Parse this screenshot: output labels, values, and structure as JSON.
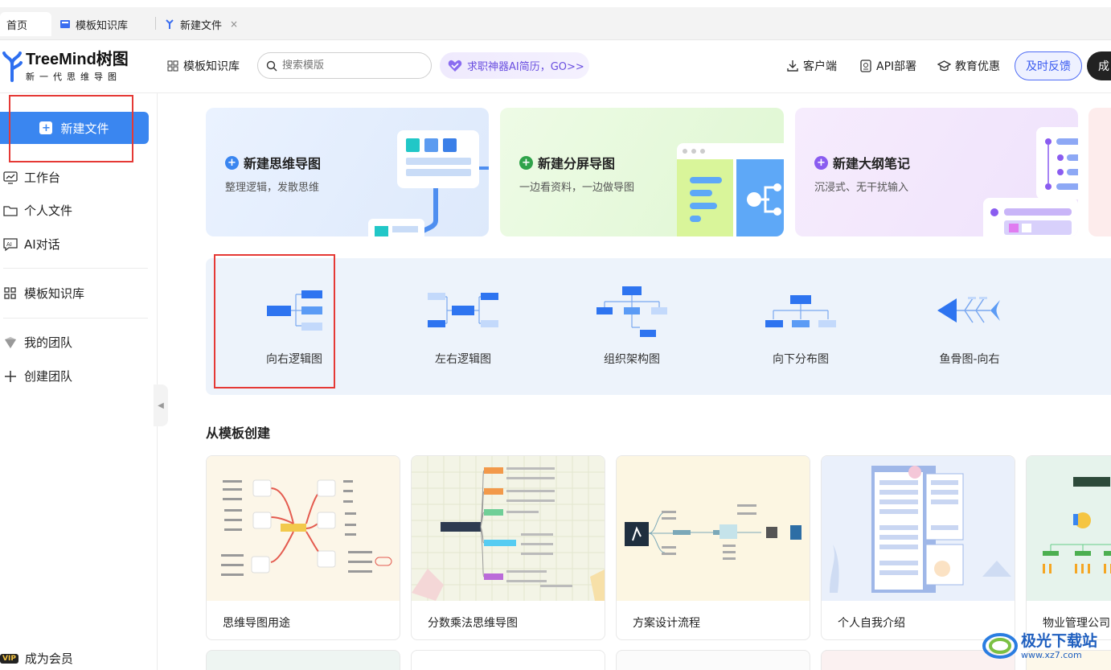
{
  "tabs": [
    {
      "label": "首页"
    },
    {
      "label": "模板知识库"
    },
    {
      "label": "新建文件",
      "close": "×"
    }
  ],
  "logo": {
    "name": "TreeMind",
    "name_cn": "树图",
    "tagline": "新一代思维导图"
  },
  "topbar": {
    "template_library": "模板知识库",
    "search_placeholder": "搜索模版",
    "promo": "求职神器AI简历，GO>>",
    "client": "客户端",
    "api": "API部署",
    "edu": "教育优惠",
    "feedback": "及时反馈",
    "member_btn": "成"
  },
  "sidebar": {
    "new_file": "新建文件",
    "items": [
      {
        "label": "工作台",
        "icon": "monitor-icon"
      },
      {
        "label": "个人文件",
        "icon": "folder-icon"
      },
      {
        "label": "AI对话",
        "icon": "ai-chat-icon"
      },
      {
        "label": "模板知识库",
        "icon": "grid-icon"
      },
      {
        "label": "我的团队",
        "icon": "team-icon"
      },
      {
        "label": "创建团队",
        "icon": "plus-icon"
      }
    ],
    "vip_badge": "VIP",
    "vip_label": "成为会员"
  },
  "create_cards": [
    {
      "title": "新建思维导图",
      "desc": "整理逻辑，发散思维",
      "color": "#3a86f0"
    },
    {
      "title": "新建分屏导图",
      "desc": "一边看资料，一边做导图",
      "color": "#2fa34a"
    },
    {
      "title": "新建大纲笔记",
      "desc": "沉浸式、无干扰输入",
      "color": "#8a5cf0"
    }
  ],
  "map_types": [
    {
      "label": "向右逻辑图"
    },
    {
      "label": "左右逻辑图"
    },
    {
      "label": "组织架构图"
    },
    {
      "label": "向下分布图"
    },
    {
      "label": "鱼骨图-向右"
    }
  ],
  "section_title": "从模板创建",
  "templates": [
    {
      "name": "思维导图用途"
    },
    {
      "name": "分数乘法思维导图"
    },
    {
      "name": "方案设计流程"
    },
    {
      "name": "个人自我介绍"
    },
    {
      "name": "物业管理公司"
    }
  ],
  "watermark": "极光下载站",
  "watermark_url": "www.xz7.com"
}
